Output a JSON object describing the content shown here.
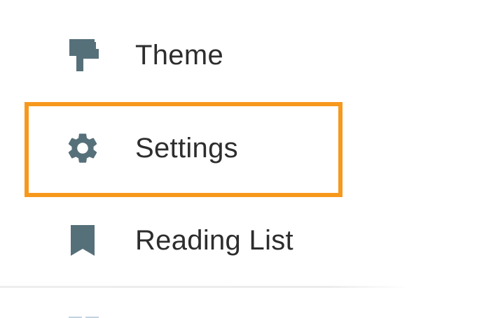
{
  "menu": {
    "items": [
      {
        "id": "theme",
        "label": "Theme",
        "icon": "paint-roller-icon"
      },
      {
        "id": "settings",
        "label": "Settings",
        "icon": "gear-icon",
        "highlighted": true
      },
      {
        "id": "reading_list",
        "label": "Reading List",
        "icon": "bookmark-icon"
      }
    ]
  },
  "colors": {
    "icon": "#56707a",
    "text": "#2d2d2d",
    "highlight": "#f7981d",
    "divider": "#ececec",
    "peek_icon": "#c3d3e0"
  }
}
